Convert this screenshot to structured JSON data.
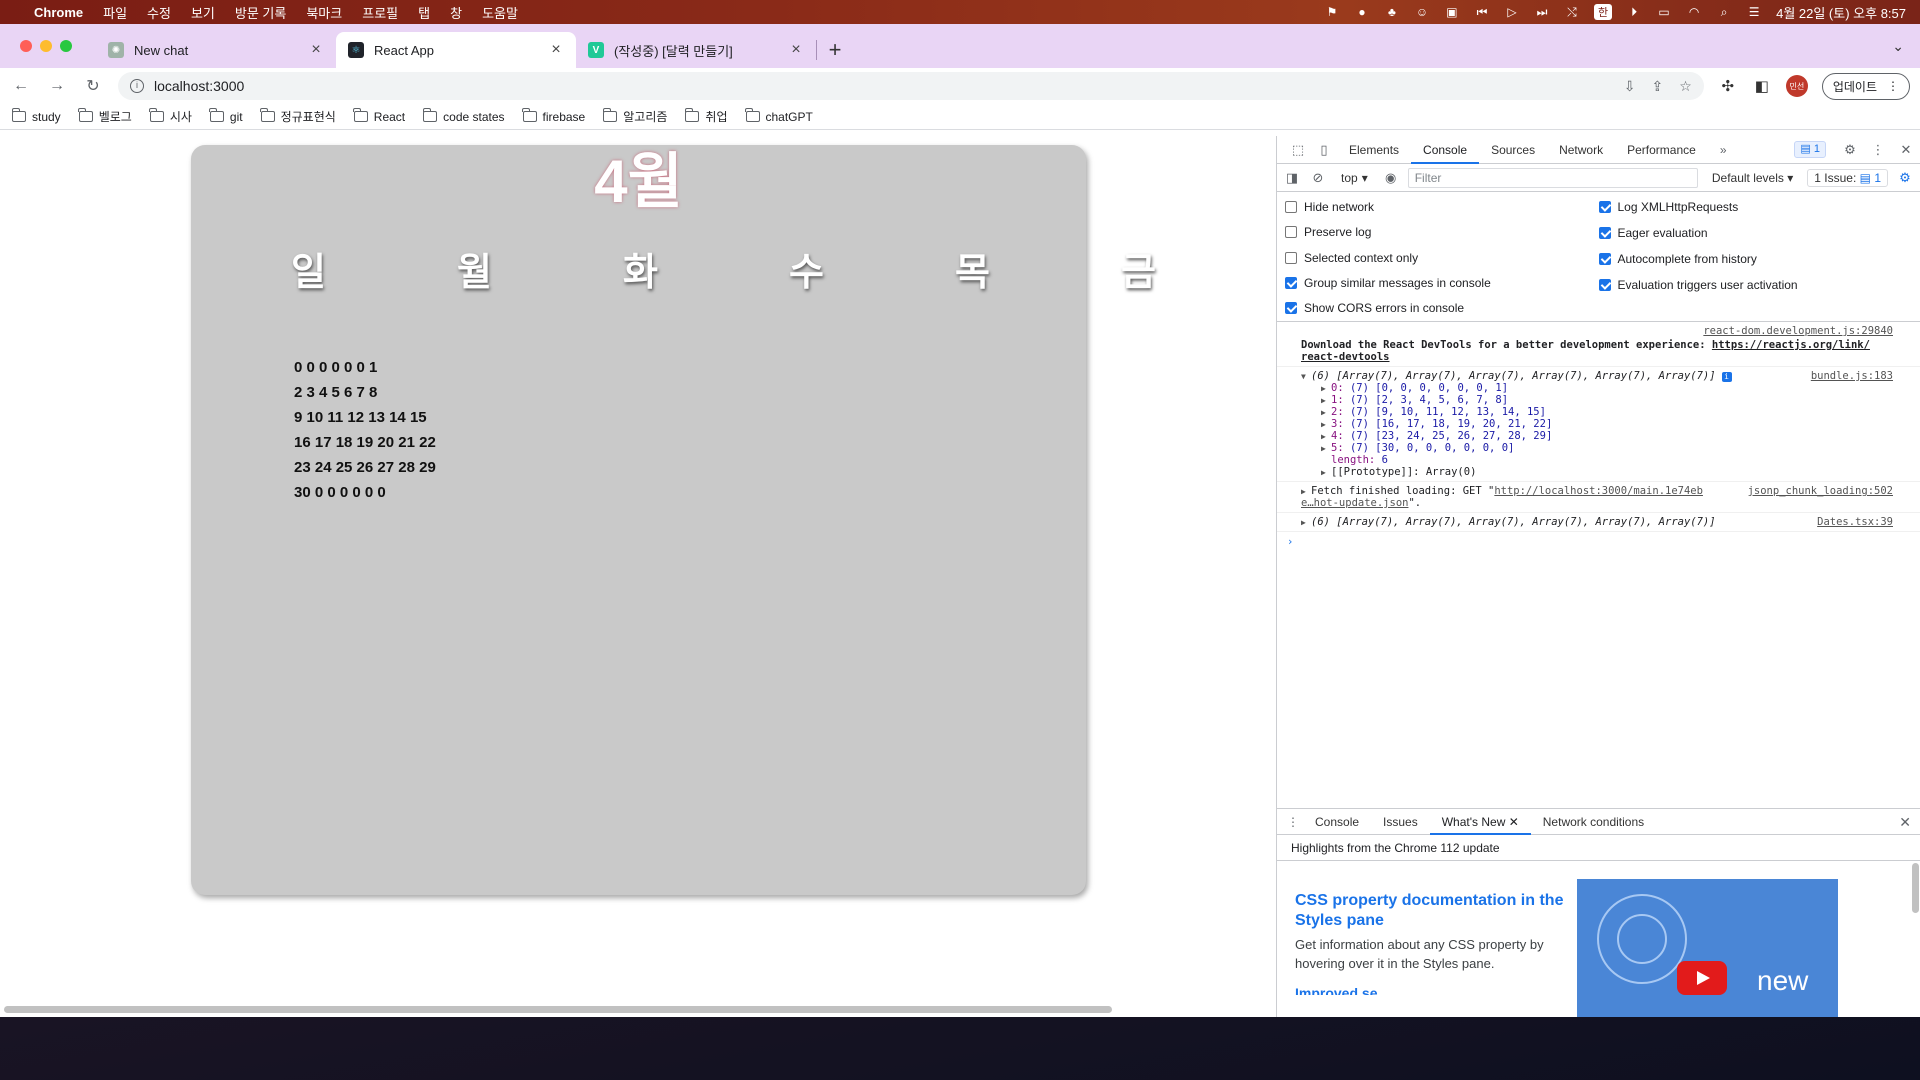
{
  "menubar": {
    "app_name": "Chrome",
    "menus": [
      "파일",
      "수정",
      "보기",
      "방문 기록",
      "북마크",
      "프로필",
      "탭",
      "창",
      "도움말"
    ],
    "input_source": "한",
    "clock": "4월 22일 (토) 오후 8:57"
  },
  "tabs": [
    {
      "title": "New chat",
      "favicon_color": "#9fb3a8"
    },
    {
      "title": "React App",
      "favicon_color": "#20232a"
    },
    {
      "title": "(작성중) [달력 만들기]",
      "favicon_color": "#20c997",
      "favicon_letter": "V"
    }
  ],
  "toolbar": {
    "url": "localhost:3000",
    "profile_label": "민선",
    "update_label": "업데이트"
  },
  "bookmarks": [
    "study",
    "벨로그",
    "시사",
    "git",
    "정규표현식",
    "React",
    "code states",
    "firebase",
    "알고리즘",
    "취업",
    "chatGPT"
  ],
  "calendar": {
    "month": "4월",
    "weekdays": [
      "일",
      "월",
      "화",
      "수",
      "목",
      "금"
    ],
    "rows": [
      "0 0 0 0 0 0 1",
      "2 3 4 5 6 7 8",
      "9 10 11 12 13 14 15",
      "16 17 18 19 20 21 22",
      "23 24 25 26 27 28 29",
      "30 0 0 0 0 0 0"
    ]
  },
  "devtools": {
    "tabs": [
      "Elements",
      "Console",
      "Sources",
      "Network",
      "Performance"
    ],
    "more": "»",
    "issues_badge": "1",
    "context": "top",
    "filter_placeholder": "Filter",
    "levels": "Default levels",
    "issue_pill_label": "1 Issue:",
    "issue_pill_count": "1",
    "settings_left": [
      {
        "label": "Hide network",
        "checked": false
      },
      {
        "label": "Preserve log",
        "checked": false
      },
      {
        "label": "Selected context only",
        "checked": false
      },
      {
        "label": "Group similar messages in console",
        "checked": true
      },
      {
        "label": "Show CORS errors in console",
        "checked": true
      }
    ],
    "settings_right": [
      {
        "label": "Log XMLHttpRequests",
        "checked": true
      },
      {
        "label": "Eager evaluation",
        "checked": true
      },
      {
        "label": "Autocomplete from history",
        "checked": true
      },
      {
        "label": "Evaluation triggers user activation",
        "checked": true
      }
    ],
    "console": {
      "devtools_src": "react-dom.development.js:29840",
      "devtools_msg": "Download the React DevTools for a better development experience: ",
      "devtools_link_1": "https://reactjs.org/link/",
      "devtools_link_2": "react-devtools",
      "array_summary": "(6) [Array(7), Array(7), Array(7), Array(7), Array(7), Array(7)]",
      "array_src": "bundle.js:183",
      "array_items": [
        {
          "key": "0:",
          "val": "(7) [0, 0, 0, 0, 0, 0, 1]"
        },
        {
          "key": "1:",
          "val": "(7) [2, 3, 4, 5, 6, 7, 8]"
        },
        {
          "key": "2:",
          "val": "(7) [9, 10, 11, 12, 13, 14, 15]"
        },
        {
          "key": "3:",
          "val": "(7) [16, 17, 18, 19, 20, 21, 22]"
        },
        {
          "key": "4:",
          "val": "(7) [23, 24, 25, 26, 27, 28, 29]"
        },
        {
          "key": "5:",
          "val": "(7) [30, 0, 0, 0, 0, 0, 0]"
        }
      ],
      "length_key": "length:",
      "length_val": "6",
      "prototype": "[[Prototype]]: Array(0)",
      "fetch_prefix": "Fetch finished loading: GET \"",
      "fetch_url_1": "http://localhost:3000/main.1e74eb",
      "fetch_url_2": "e…hot-update.json",
      "fetch_suffix": "\".",
      "fetch_src": "jsonp_chunk_loading:502",
      "array2_summary": "(6) [Array(7), Array(7), Array(7), Array(7), Array(7), Array(7)]",
      "array2_src": "Dates.tsx:39",
      "prompt": "›"
    },
    "drawer": {
      "tabs": [
        "Console",
        "Issues",
        "What's New",
        "Network conditions"
      ],
      "highlights": "Highlights from the Chrome 112 update",
      "whatsnew_title": "CSS property documentation in the Styles pane",
      "whatsnew_desc": "Get information about any CSS property by hovering over it in the Styles pane.",
      "whatsnew_next": "Improved se",
      "video_label": "new"
    }
  }
}
